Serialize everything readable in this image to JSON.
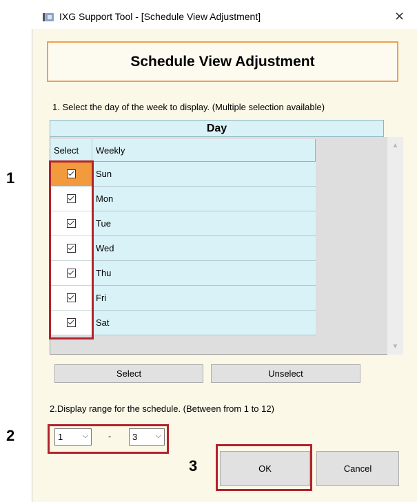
{
  "window": {
    "title": "IXG Support Tool - [Schedule View Adjustment]",
    "close": "×"
  },
  "header": {
    "title": "Schedule View Adjustment"
  },
  "instruction1": "1. Select the day of the week to display. (Multiple selection available)",
  "day_table": {
    "group_header": "Day",
    "columns": [
      "Select",
      "Weekly"
    ],
    "rows": [
      {
        "day": "Sun",
        "checked": true
      },
      {
        "day": "Mon",
        "checked": true
      },
      {
        "day": "Tue",
        "checked": true
      },
      {
        "day": "Wed",
        "checked": true
      },
      {
        "day": "Thu",
        "checked": true
      },
      {
        "day": "Fri",
        "checked": true
      },
      {
        "day": "Sat",
        "checked": true
      }
    ]
  },
  "buttons": {
    "select": "Select",
    "unselect": "Unselect",
    "ok": "OK",
    "cancel": "Cancel"
  },
  "instruction2": "2.Display range for the schedule. (Between from 1 to 12)",
  "range": {
    "from": "1",
    "separator": "-",
    "to": "3"
  },
  "callouts": {
    "one": "1",
    "two": "2",
    "three": "3"
  },
  "colors": {
    "highlight": "#b1232b",
    "accent_orange": "#f29a3e",
    "table_cyan": "#d9f2f7"
  }
}
